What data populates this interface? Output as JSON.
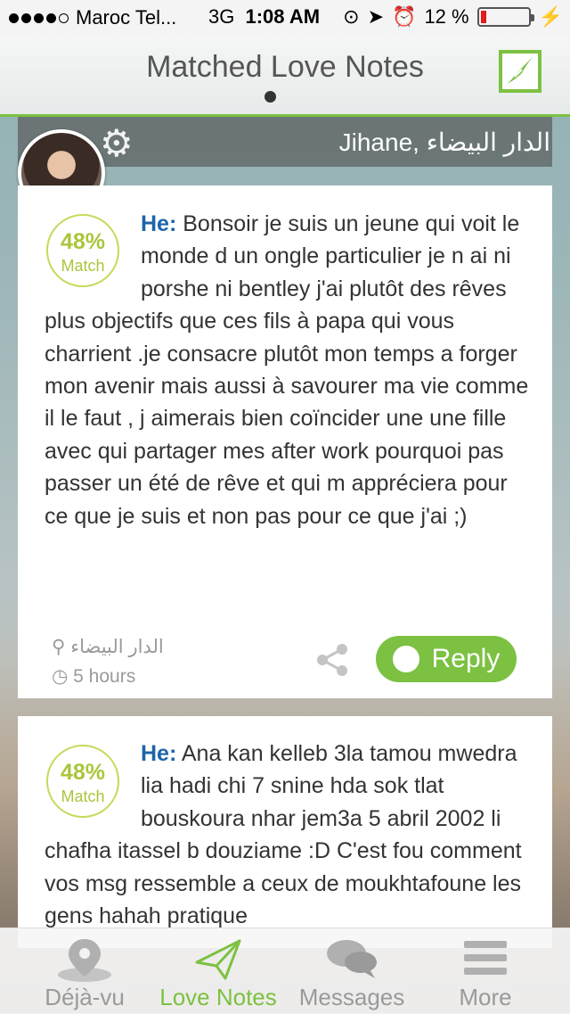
{
  "status_bar": {
    "carrier": "Maroc Tel...",
    "network": "3G",
    "time": "1:08 AM",
    "battery": "12 %",
    "battery_level": 0.12
  },
  "nav": {
    "title": "Matched Love Notes"
  },
  "user": {
    "name": "Jihane, الدار البيضاء"
  },
  "notes": [
    {
      "match_percent": "48%",
      "match_label": "Match",
      "prefix": "He:",
      "text": "Bonsoir je suis un jeune qui voit le monde d un ongle particulier  je n ai ni porshe ni bentley j'ai plutôt des rêves plus objectifs que ces fils à papa qui vous charrient .je consacre plutôt mon temps a forger mon avenir mais aussi à savourer ma vie comme il le faut  , j aimerais bien coïncider une une fille avec qui partager mes after work pourquoi pas passer un été de rêve et qui m appréciera pour ce que je suis et non pas pour ce que j'ai  ;)",
      "location": "الدار البيضاء",
      "time": "5 hours",
      "reply_label": "Reply"
    },
    {
      "match_percent": "48%",
      "match_label": "Match",
      "prefix": "He:",
      "text": "Ana kan kelleb 3la tamou mwedra lia hadi chi 7 snine hda sok tlat bouskoura nhar jem3a 5 abril 2002 li chafha itassel b douziame :D C'est fou comment vos msg ressemble a ceux de moukhtafoune les gens hahah pratique"
    }
  ],
  "tabs": [
    {
      "label": "Déjà-vu",
      "icon": "map-pin-icon"
    },
    {
      "label": "Love Notes",
      "icon": "paper-plane-icon"
    },
    {
      "label": "Messages",
      "icon": "chat-bubbles-icon"
    },
    {
      "label": "More",
      "icon": "menu-icon"
    }
  ],
  "colors": {
    "accent": "#7cc142",
    "he_label": "#1d64a8",
    "match": "#a9c63b"
  }
}
